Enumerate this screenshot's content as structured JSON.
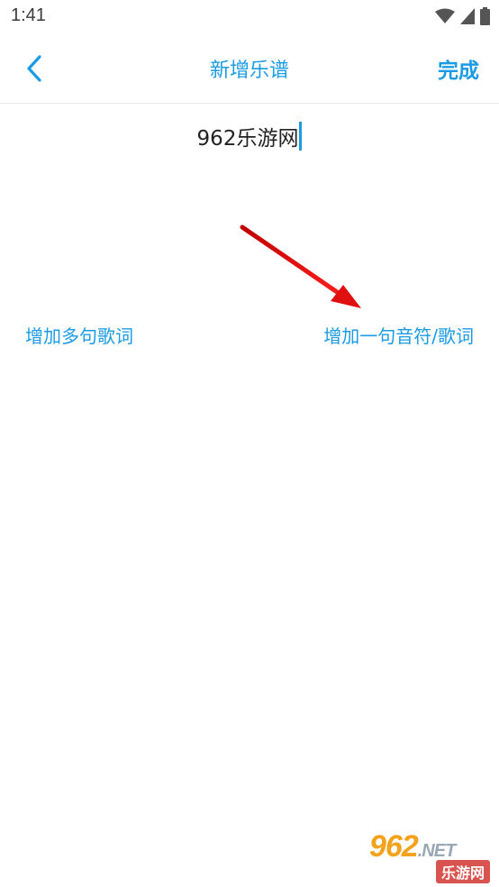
{
  "status_bar": {
    "time": "1:41"
  },
  "header": {
    "title": "新增乐谱",
    "done_label": "完成"
  },
  "title_input": {
    "value": "962乐游网"
  },
  "actions": {
    "add_multi_lyrics": "增加多句歌词",
    "add_note_lyric": "增加一句音符/歌词"
  },
  "watermark": {
    "brand": "962",
    "domain": ".NET",
    "site_name": "乐游网"
  },
  "colors": {
    "accent": "#1a9be3",
    "arrow": "#e01010"
  }
}
